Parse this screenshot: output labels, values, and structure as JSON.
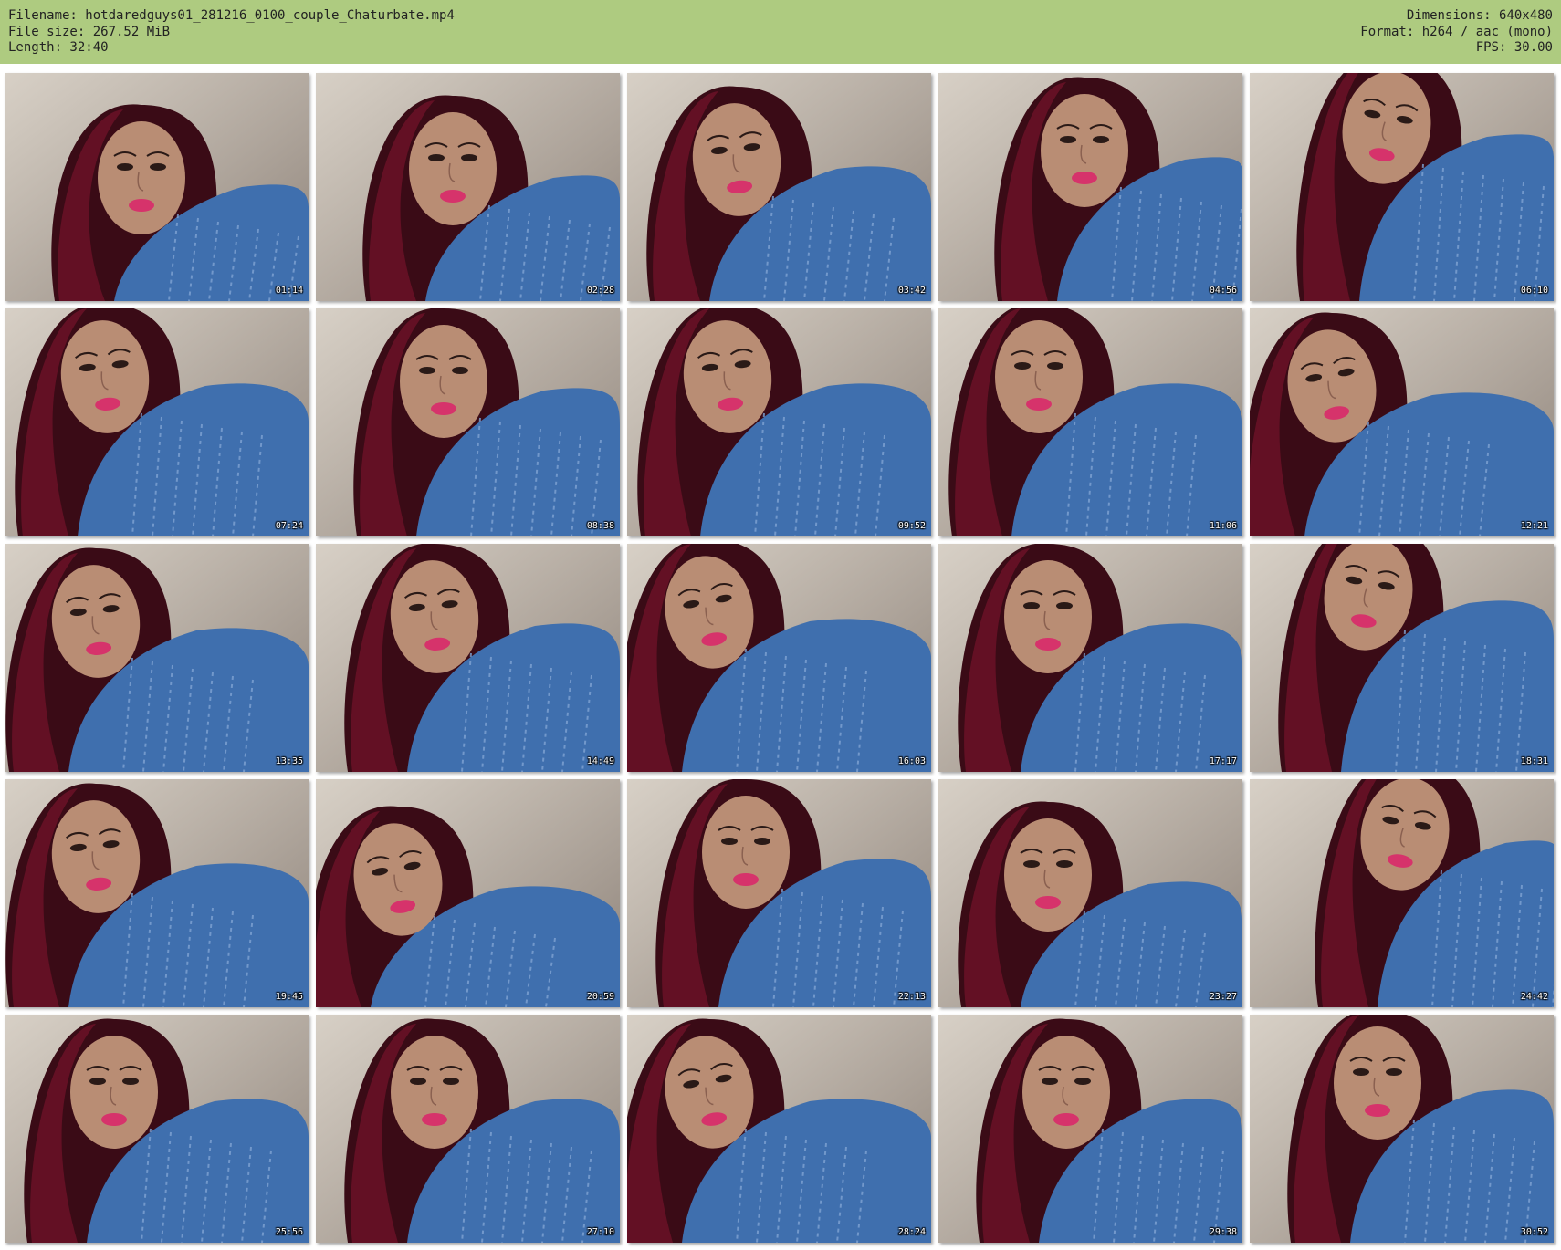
{
  "header": {
    "filename_line": "Filename: hotdaredguys01_281216_0100_couple_Chaturbate.mp4",
    "filesize_line": "File size: 267.52 MiB",
    "length_line": "Length: 32:40",
    "dimensions_line": "Dimensions: 640x480",
    "format_line": "Format: h264 / aac (mono)",
    "fps_line": "FPS: 30.00"
  },
  "thumbnails": [
    {
      "time": "01:14"
    },
    {
      "time": "02:28"
    },
    {
      "time": "03:42"
    },
    {
      "time": "04:56"
    },
    {
      "time": "06:10"
    },
    {
      "time": "07:24"
    },
    {
      "time": "08:38"
    },
    {
      "time": "09:52"
    },
    {
      "time": "11:06"
    },
    {
      "time": "12:21"
    },
    {
      "time": "13:35"
    },
    {
      "time": "14:49"
    },
    {
      "time": "16:03"
    },
    {
      "time": "17:17"
    },
    {
      "time": "18:31"
    },
    {
      "time": "19:45"
    },
    {
      "time": "20:59"
    },
    {
      "time": "22:13"
    },
    {
      "time": "23:27"
    },
    {
      "time": "24:42"
    },
    {
      "time": "25:56"
    },
    {
      "time": "27:10"
    },
    {
      "time": "28:24"
    },
    {
      "time": "29:38"
    },
    {
      "time": "30:52"
    }
  ],
  "colors": {
    "header_bg": "#aecb80",
    "wall": "#cfc7bd",
    "wall_shadow": "#6f6259",
    "hair": "#3a0b16",
    "hair_red": "#6e1228",
    "skin": "#b98d74",
    "lips": "#d6336b",
    "jacket": "#3f6fae",
    "jacket_light": "#7fa3d3"
  }
}
